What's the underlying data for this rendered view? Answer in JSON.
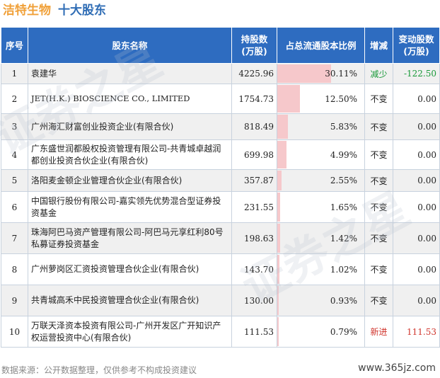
{
  "header": {
    "company": "洁特生物",
    "subtitle": "十大股东"
  },
  "watermark": "证券之星",
  "table": {
    "columns": [
      {
        "key": "seq",
        "label": "序号"
      },
      {
        "key": "name",
        "label": "股东名称"
      },
      {
        "key": "shares",
        "label": "持股数 (万股)"
      },
      {
        "key": "ratio",
        "label": "占总流通股本比例"
      },
      {
        "key": "change",
        "label": "增减"
      },
      {
        "key": "delta",
        "label": "变动股数 (万股)"
      }
    ],
    "rows": [
      {
        "seq": "1",
        "name": "袁建华",
        "shares": "4225.96",
        "ratio": "30.11%",
        "ratio_value": 30.11,
        "change": "减少",
        "delta": "-122.50",
        "change_color": "#1a9a3a"
      },
      {
        "seq": "2",
        "name": "JET(H.K.) BIOSCIENCE CO., LIMITED",
        "shares": "1754.73",
        "ratio": "12.50%",
        "ratio_value": 12.5,
        "change": "不变",
        "delta": "0.00",
        "change_color": "#222222"
      },
      {
        "seq": "3",
        "name": "广州海汇财富创业投资企业(有限合伙)",
        "shares": "818.49",
        "ratio": "5.83%",
        "ratio_value": 5.83,
        "change": "不变",
        "delta": "0.00",
        "change_color": "#222222"
      },
      {
        "seq": "4",
        "name": "广东盛世润都股权投资管理有限公司-共青城卓越润都创业投资合伙企业(有限合伙)",
        "shares": "699.98",
        "ratio": "4.99%",
        "ratio_value": 4.99,
        "change": "不变",
        "delta": "0.00",
        "change_color": "#222222"
      },
      {
        "seq": "5",
        "name": "洛阳麦金顿企业管理合伙企业(有限合伙)",
        "shares": "357.87",
        "ratio": "2.55%",
        "ratio_value": 2.55,
        "change": "不变",
        "delta": "0.00",
        "change_color": "#222222"
      },
      {
        "seq": "6",
        "name": "中国银行股份有限公司-嘉实领先优势混合型证券投资基金",
        "shares": "231.55",
        "ratio": "1.65%",
        "ratio_value": 1.65,
        "change": "不变",
        "delta": "0.00",
        "change_color": "#222222"
      },
      {
        "seq": "7",
        "name": "珠海阿巴马资产管理有限公司-阿巴马元享红利80号私募证券投资基金",
        "shares": "198.63",
        "ratio": "1.42%",
        "ratio_value": 1.42,
        "change": "不变",
        "delta": "0.00",
        "change_color": "#222222"
      },
      {
        "seq": "8",
        "name": "广州萝岗区汇资投资管理合伙企业(有限合伙)",
        "shares": "143.70",
        "ratio": "1.02%",
        "ratio_value": 1.02,
        "change": "不变",
        "delta": "0.00",
        "change_color": "#222222"
      },
      {
        "seq": "9",
        "name": "共青城高禾中民投资管理合伙企业(有限合伙)",
        "shares": "130.00",
        "ratio": "0.93%",
        "ratio_value": 0.93,
        "change": "不变",
        "delta": "0.00",
        "change_color": "#222222"
      },
      {
        "seq": "10",
        "name": "万联天泽资本投资有限公司-广州开发区广开知识产权运营投资中心(有限合伙)",
        "shares": "111.53",
        "ratio": "0.79%",
        "ratio_value": 0.79,
        "change": "新进",
        "delta": "111.53",
        "change_color": "#d0342c"
      }
    ]
  },
  "footer": {
    "source": "数据来源：公开数据整理，仅供参考不构成投资建议",
    "site": "www.365jz.com"
  },
  "colors": {
    "header_bg": "#2e6cc0",
    "bar": "#f6c8cb",
    "decrease": "#1a9a3a",
    "new": "#d0342c"
  }
}
